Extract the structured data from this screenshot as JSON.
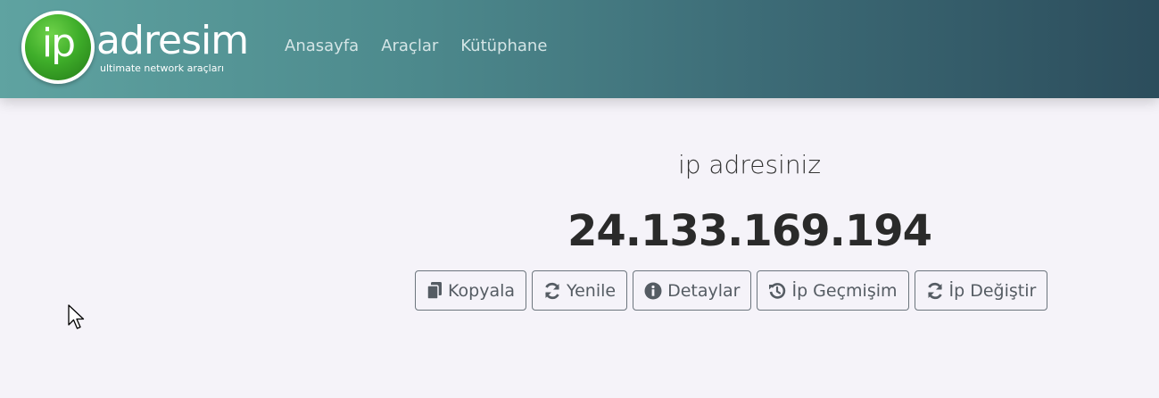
{
  "brand": {
    "logo_mark": "ip",
    "logo_word": "adresim",
    "tagline": "ultimate network araçları",
    "color": "#3fae2a"
  },
  "nav": {
    "items": [
      {
        "label": "Anasayfa"
      },
      {
        "label": "Araçlar"
      },
      {
        "label": "Kütüphane"
      }
    ]
  },
  "main": {
    "label": "ip adresiniz",
    "ip": "24.133.169.194"
  },
  "actions": [
    {
      "label": "Kopyala",
      "icon": "copy-icon"
    },
    {
      "label": "Yenile",
      "icon": "refresh-icon"
    },
    {
      "label": "Detaylar",
      "icon": "info-icon"
    },
    {
      "label": "İp Geçmişim",
      "icon": "history-icon"
    },
    {
      "label": "İp Değiştir",
      "icon": "refresh-icon"
    }
  ]
}
